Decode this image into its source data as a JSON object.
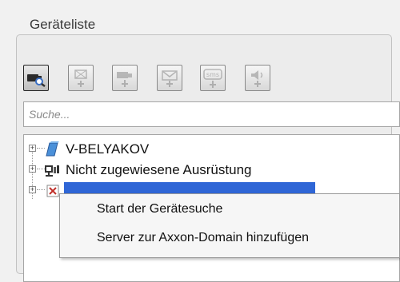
{
  "group": {
    "title": "Geräteliste"
  },
  "toolbar": {
    "buttons": [
      {
        "icon": "camera-search-icon",
        "state": "active"
      },
      {
        "icon": "add-monitor-icon",
        "state": "disabled"
      },
      {
        "icon": "add-camera-icon",
        "state": "disabled"
      },
      {
        "icon": "add-email-icon",
        "state": "disabled"
      },
      {
        "icon": "add-sms-icon",
        "state": "disabled",
        "badge": "sms"
      },
      {
        "icon": "add-speaker-icon",
        "state": "disabled"
      }
    ]
  },
  "search": {
    "placeholder": "Suche..."
  },
  "tree": {
    "items": [
      {
        "label": "V-BELYAKOV",
        "icon": "domain-icon"
      },
      {
        "label": "Nicht zugewiesene Ausrüstung",
        "icon": "network-equipment-icon"
      },
      {
        "label": "",
        "icon": "server-error-icon",
        "selected": true
      }
    ]
  },
  "context_menu": {
    "items": [
      {
        "label": "Start der Gerätesuche"
      },
      {
        "label": "Server zur Axxon-Domain hinzufügen"
      }
    ]
  },
  "colors": {
    "selection": "#2f66d6",
    "panel_border": "#c2c2c2",
    "window_bg": "#f1f1f1"
  }
}
